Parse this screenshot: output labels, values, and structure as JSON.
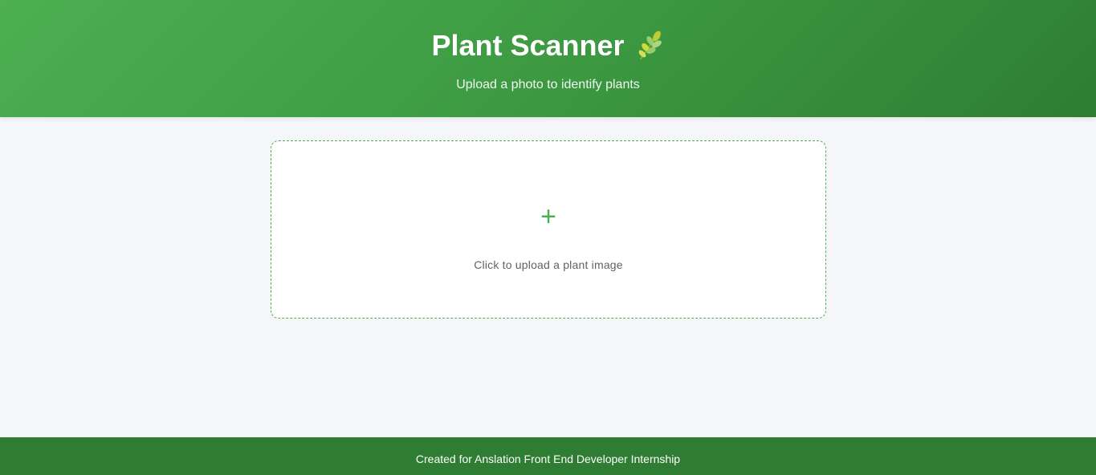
{
  "header": {
    "title": "Plant Scanner",
    "title_icon": "leaf-icon",
    "subtitle": "Upload a photo to identify plants"
  },
  "upload": {
    "icon": "plus-icon",
    "plus_glyph": "+",
    "label": "Click to upload a plant image"
  },
  "footer": {
    "text": "Created for Anslation Front End Developer Internship"
  },
  "colors": {
    "header_start": "#4caf50",
    "header_end": "#2e7d32",
    "accent": "#4caf50",
    "footer_bg": "#2e7d32",
    "page_bg": "#f5f6fa"
  }
}
